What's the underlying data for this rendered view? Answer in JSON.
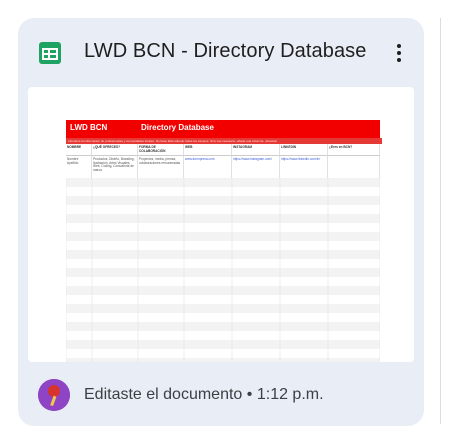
{
  "card": {
    "title": "LWD BCN - Directory Database",
    "icon": "google-sheets-icon",
    "menu_icon": "more-vert-icon",
    "activity": {
      "prefix": "Editaste el documento",
      "separator": "•",
      "time": "1:12 p.m."
    }
  },
  "thumbnail": {
    "brand": "LWD BCN",
    "sheet_title": "Directory Database",
    "subtitle": "Introduce la información de profesionales y comunidades locales. No hace falta rellenar todos los campos. Si lo ves necesario, añade una columna. ¡Gracias!",
    "columns": [
      "NOMBRE",
      "¿QUÉ OFRECES?",
      "FORMA DE COLABORACIÓN",
      "WEB",
      "INSTAGRAM",
      "LINKEDIN",
      "¿Eres en BCN?"
    ],
    "row1": {
      "name": "Nombre Apellido",
      "offer": "Productos, Diseño, Branding, Ilustración, Artes Visuales, Web, Coding, Consultoría de marca",
      "collab": "Proyectos, media, prensa, colaboraciones remuneradas",
      "web": "www.tuempresa.com",
      "instagram": "https://www.instagram.com/",
      "linkedin": "https://www.linkedin.com/in/",
      "bcn": ""
    }
  }
}
